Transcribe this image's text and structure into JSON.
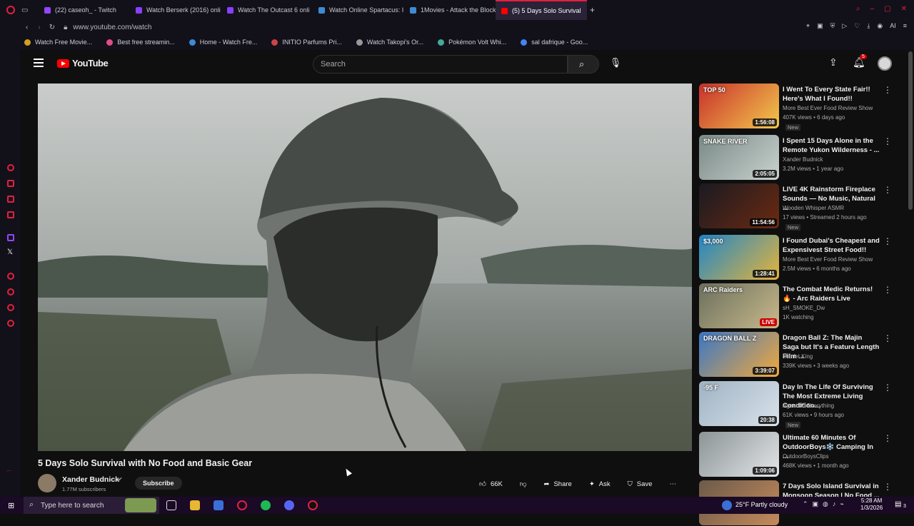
{
  "browser": {
    "tabs": [
      {
        "label": "(22) caseoh_ - Twitch",
        "color": "#9147ff"
      },
      {
        "label": "Watch Berserk (2016) onli",
        "color": "#8a3ffc"
      },
      {
        "label": "Watch The Outcast 6 onli",
        "color": "#8a3ffc"
      },
      {
        "label": "Watch Online Spartacus: I",
        "color": "#3d8bd4"
      },
      {
        "label": "1Movies - Attack the Block",
        "color": "#3d8bd4"
      },
      {
        "label": "(5) 5 Days Solo Survival",
        "color": "#ff0000"
      }
    ],
    "url": "www.youtube.com/watch",
    "bookmarks": [
      {
        "label": "Watch Free Movie...",
        "color": "#d4a017"
      },
      {
        "label": "Best free streamin...",
        "color": "#e24c8a"
      },
      {
        "label": "Home - Watch Fre...",
        "color": "#3d8bd4"
      },
      {
        "label": "INITIO Parfums Pri...",
        "color": "#c44"
      },
      {
        "label": "Watch Takopi's Or...",
        "color": "#999"
      },
      {
        "label": "Pokémon Volt Whi...",
        "color": "#4a9"
      },
      {
        "label": "sal dafrique - Goo...",
        "color": "#4285f4"
      }
    ]
  },
  "youtube": {
    "logo": "YouTube",
    "search_placeholder": "Search",
    "notification_count": "5",
    "video": {
      "title": "5 Days Solo Survival with No Food and Basic Gear",
      "channel": "Xander Budnick",
      "subscribers": "1.77M subscribers",
      "subscribe_label": "Subscribe",
      "likes": "66K",
      "share_label": "Share",
      "ask_label": "Ask",
      "save_label": "Save"
    },
    "recommendations": [
      {
        "title": "I Went To Every State Fair!! Here's What I Found!!",
        "channel": "More Best Ever Food Review Show",
        "meta": "407K views • 6 days ago",
        "duration": "1:56:08",
        "new": "New",
        "bg": "#c9302c",
        "bg2": "#f3c94c",
        "badge": "TOP 50"
      },
      {
        "title": "I Spent 15 Days Alone in the Remote Yukon Wilderness - ...",
        "channel": "Xander Budnick",
        "meta": "3.2M views • 1 year ago",
        "duration": "2:05:05",
        "new": "",
        "bg": "#7a8a86",
        "bg2": "#c9d2cf",
        "badge": "SNAKE RIVER"
      },
      {
        "title": "LIVE 4K Rainstorm Fireplace Sounds — No Music, Natural ...",
        "channel": "Wooden Whisper ASMR",
        "meta": "17 views • Streamed 2 hours ago",
        "duration": "11:54:56",
        "new": "New",
        "bg": "#1a1a22",
        "bg2": "#6b2a10",
        "badge": ""
      },
      {
        "title": "I Found Dubai's Cheapest and Expensivest Street Food!!",
        "channel": "More Best Ever Food Review Show",
        "meta": "2.5M views • 6 months ago",
        "duration": "1:28:41",
        "new": "",
        "bg": "#1f86c9",
        "bg2": "#e5b43a",
        "badge": "$3,000"
      },
      {
        "title": "The Combat Medic Returns! 🔥 - Arc Raiders Live",
        "channel": "sH_SMOKE_Dw",
        "meta": "1K watching",
        "duration": "LIVE",
        "new": "",
        "bg": "#6b6f5e",
        "bg2": "#c8b98a",
        "badge": "ARC Raiders"
      },
      {
        "title": "Dragon Ball Z: The Majin Saga but It's a Feature Length Film ...",
        "channel": "Manlet King",
        "meta": "339K views • 3 weeks ago",
        "duration": "3:39:07",
        "new": "",
        "bg": "#3a77c6",
        "bg2": "#f2a93b",
        "badge": "DRAGON BALL Z"
      },
      {
        "title": "Day In The Life Of Surviving The Most Extreme Living Condition...",
        "channel": "Agent 00 Everything",
        "meta": "61K views • 9 hours ago",
        "duration": "20:38",
        "new": "New",
        "bg": "#9fb3c4",
        "bg2": "#d9e2ea",
        "badge": "-95 F"
      },
      {
        "title": "Ultimate 60 Minutes Of OutdoorBoys❄️ Camping In ...",
        "channel": "OutdoorBoysClips",
        "meta": "468K views • 1 month ago",
        "duration": "1:09:06",
        "new": "",
        "bg": "#8c9496",
        "bg2": "#e3e6e8",
        "badge": ""
      },
      {
        "title": "7 Days Solo Island Survival in Monsoon Season | No Food ...",
        "channel": "",
        "meta": "",
        "duration": "",
        "new": "",
        "bg": "#6c5a4a",
        "bg2": "#c58a5b",
        "badge": ""
      }
    ]
  },
  "taskbar": {
    "search_placeholder": "Type here to search",
    "weather": "25°F  Partly cloudy",
    "time": "5:28 AM",
    "date": "1/3/2026",
    "notif_count": "3"
  }
}
